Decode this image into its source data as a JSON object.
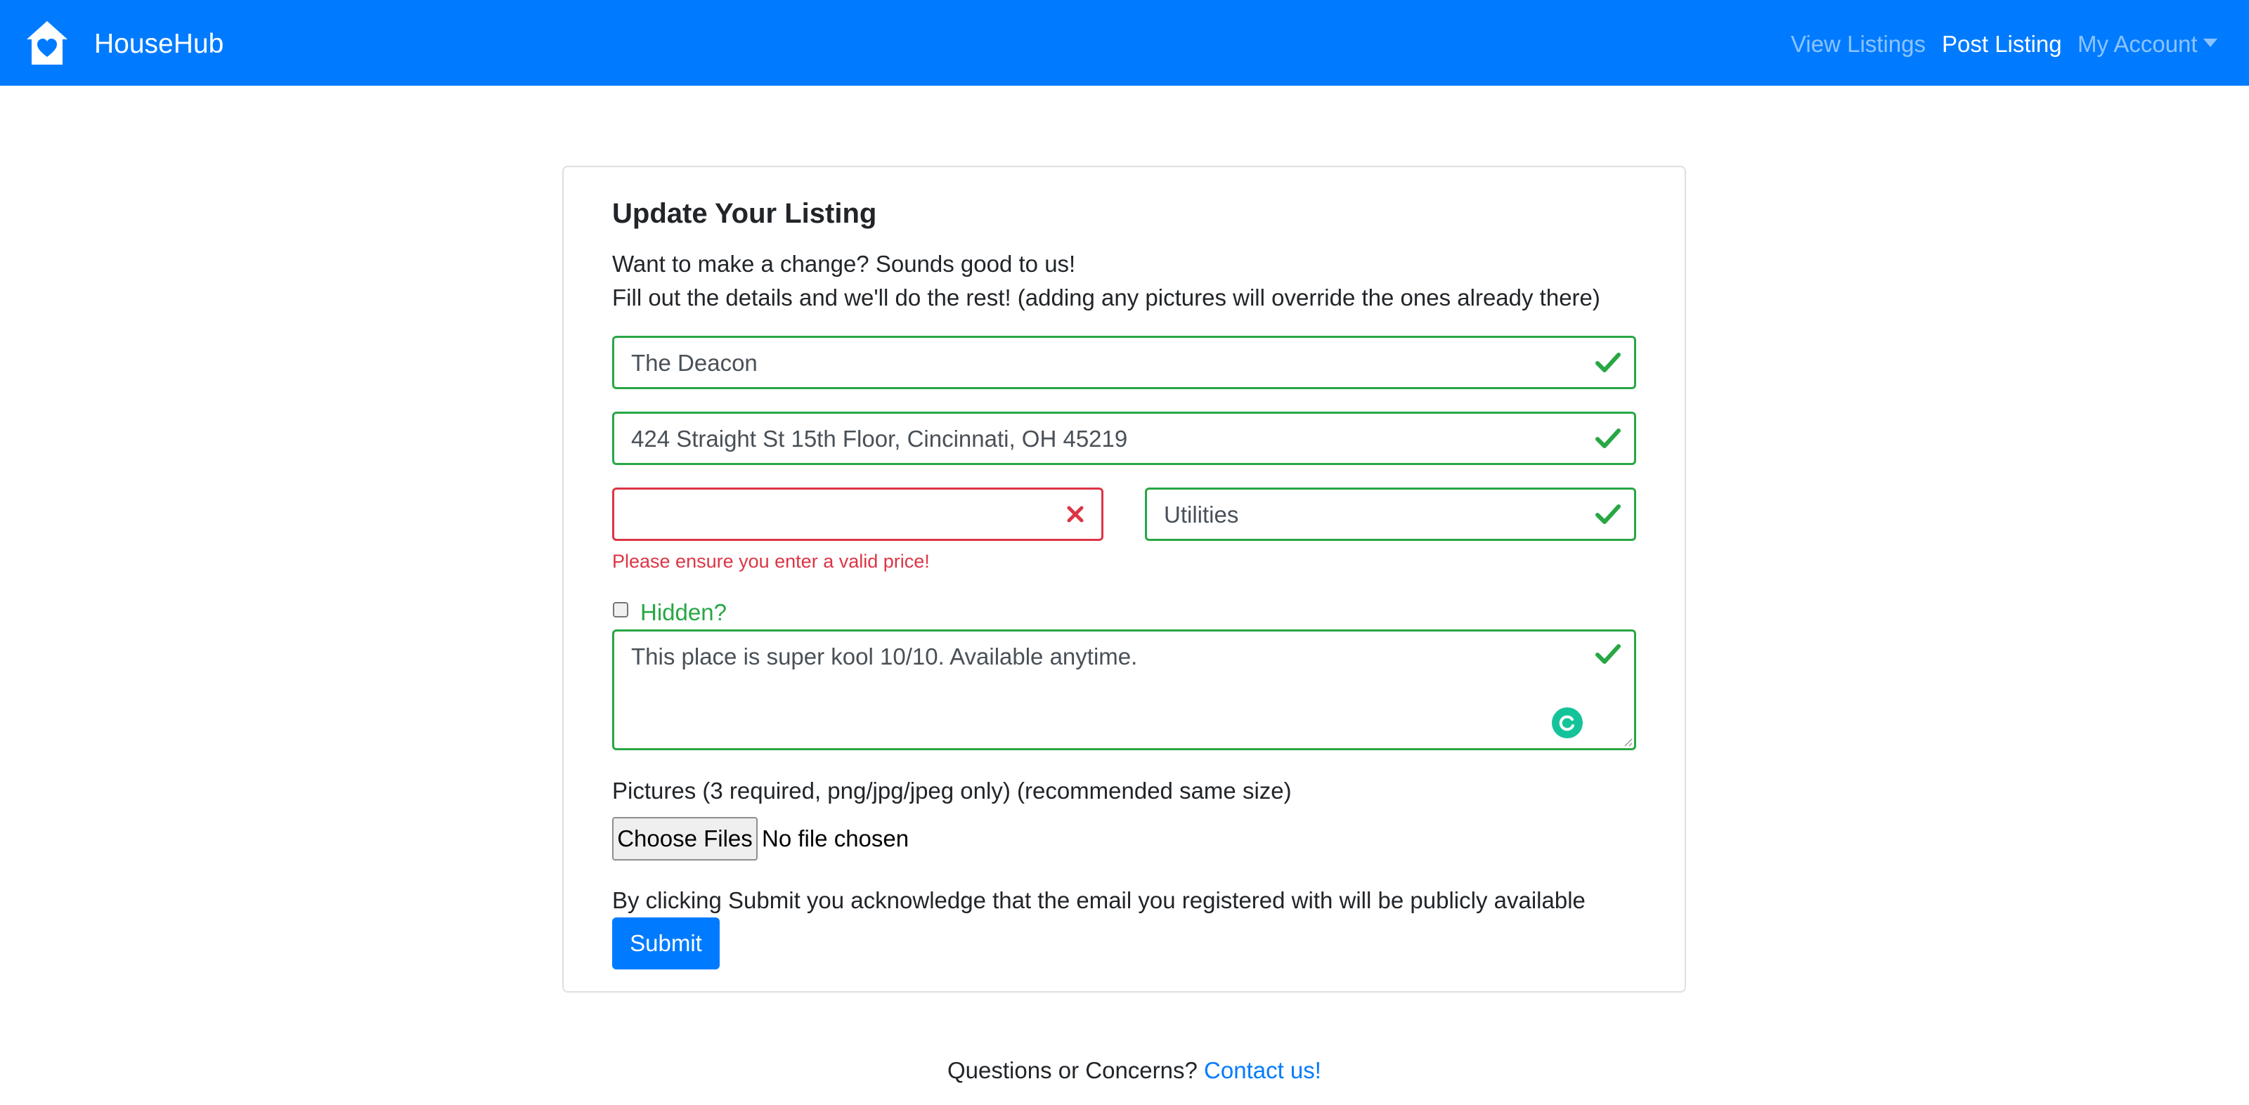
{
  "brand": {
    "name": "HouseHub",
    "logo_icon": "house-heart-icon"
  },
  "nav": {
    "view_listings": "View Listings",
    "post_listing": "Post Listing",
    "my_account": "My Account"
  },
  "form": {
    "title": "Update Your Listing",
    "intro_line1": "Want to make a change? Sounds good to us!",
    "intro_line2": "Fill out the details and we'll do the rest! (adding any pictures will override the ones already there)",
    "listing_name": "The Deacon",
    "address": "424 Straight St 15th Floor, Cincinnati, OH 45219",
    "price": "",
    "price_error": "Please ensure you enter a valid price!",
    "utilities": "Utilities",
    "hidden_label": "Hidden?",
    "hidden_checked": false,
    "description": "This place is super kool 10/10. Available anytime.",
    "pictures_label": "Pictures (3 required, png/jpg/jpeg only) (recommended same size)",
    "choose_files": "Choose Files",
    "no_file": "No file chosen",
    "acknowledgement": "By clicking Submit you acknowledge that the email you registered with will be publicly available",
    "submit": "Submit"
  },
  "footer": {
    "question": "Questions or Concerns?",
    "contact_link": "Contact us!"
  },
  "colors": {
    "primary": "#007bff",
    "valid": "#28a745",
    "invalid": "#dc3545",
    "grammarly": "#15c39a"
  }
}
